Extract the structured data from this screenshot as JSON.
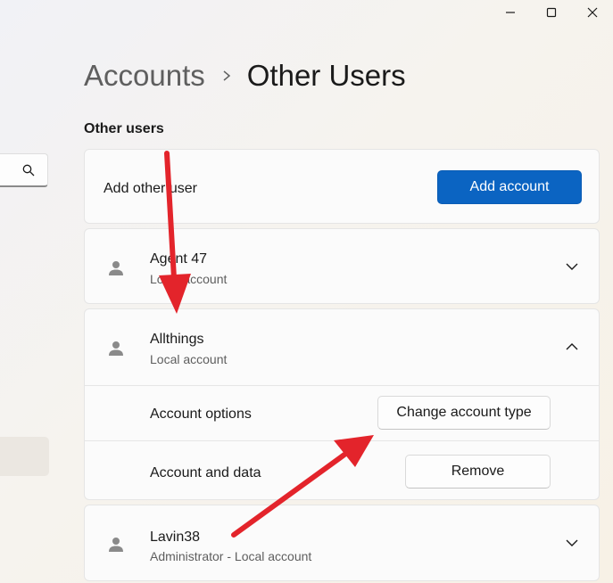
{
  "window": {
    "minimize_icon": "minimize-icon",
    "maximize_icon": "maximize-icon",
    "close_icon": "close-icon"
  },
  "breadcrumb": {
    "parent": "Accounts",
    "separator_icon": "chevron-right-icon",
    "current": "Other Users"
  },
  "section": {
    "title": "Other users"
  },
  "add_user": {
    "label": "Add other user",
    "button_label": "Add account"
  },
  "users": [
    {
      "name": "Agent 47",
      "type": "Local account",
      "expanded": false
    },
    {
      "name": "Allthings",
      "type": "Local account",
      "expanded": true,
      "options": {
        "account_options_label": "Account options",
        "change_type_button": "Change account type",
        "account_data_label": "Account and data",
        "remove_button": "Remove"
      }
    },
    {
      "name": "Lavin38",
      "type": "Administrator - Local account",
      "expanded": false
    }
  ],
  "colors": {
    "accent": "#0b64c2",
    "annotation_arrow": "#e3242b"
  }
}
